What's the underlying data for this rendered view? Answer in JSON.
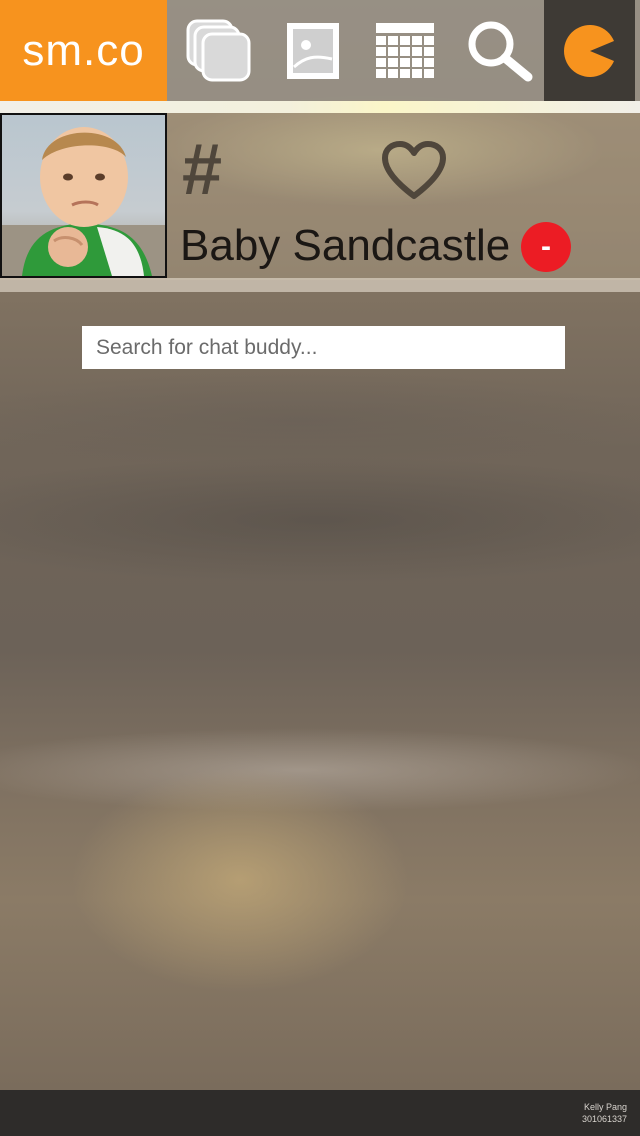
{
  "header": {
    "logo_text": "sm.co",
    "nav_icons": [
      "stack-icon",
      "image-icon",
      "calendar-icon",
      "search-icon",
      "pacman-icon"
    ],
    "accent_color": "#f7931e",
    "active_tab_color": "#3e3a35"
  },
  "profile": {
    "hash_symbol": "#",
    "name": "Baby Sandcastle",
    "remove_label": "-",
    "remove_color": "#ec1c24"
  },
  "search": {
    "placeholder": "Search for chat buddy..."
  },
  "footer": {
    "author_name": "Kelly Pang",
    "author_id": "301061337"
  }
}
